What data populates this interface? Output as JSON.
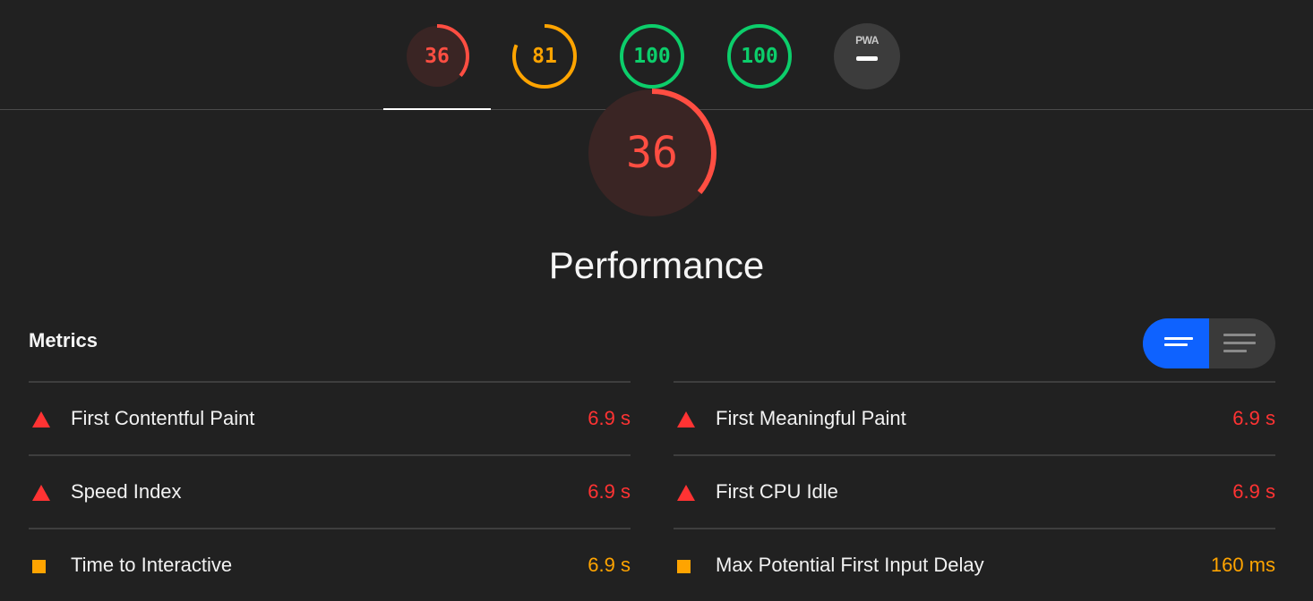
{
  "tabs": [
    {
      "score": "36",
      "color": "#ff4e42",
      "track": "#3a2524",
      "fraction": 0.36
    },
    {
      "score": "81",
      "color": "#ffa400",
      "track": "#3a3020",
      "fraction": 0.81
    },
    {
      "score": "100",
      "color": "#0cce6b",
      "track": "#1f3a2b",
      "fraction": 1.0
    },
    {
      "score": "100",
      "color": "#0cce6b",
      "track": "#1f3a2b",
      "fraction": 1.0
    },
    {
      "badge": "PWA"
    }
  ],
  "gauge": {
    "score": "36",
    "fraction": 0.36,
    "color": "#ff4e42"
  },
  "category_title": "Performance",
  "metrics": {
    "header": "Metrics",
    "left": [
      {
        "label": "First Contentful Paint",
        "value": "6.9 s",
        "status": "fail"
      },
      {
        "label": "Speed Index",
        "value": "6.9 s",
        "status": "fail"
      },
      {
        "label": "Time to Interactive",
        "value": "6.9 s",
        "status": "average"
      }
    ],
    "right": [
      {
        "label": "First Meaningful Paint",
        "value": "6.9 s",
        "status": "fail"
      },
      {
        "label": "First CPU Idle",
        "value": "6.9 s",
        "status": "fail"
      },
      {
        "label": "Max Potential First Input Delay",
        "value": "160 ms",
        "status": "average"
      }
    ]
  },
  "colors": {
    "fail": "#ff3333",
    "average": "#ffa400",
    "toggle_active": "#0e62ff"
  }
}
